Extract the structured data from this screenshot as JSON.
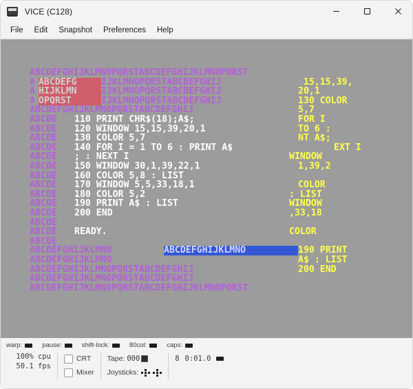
{
  "window": {
    "title": "VICE (C128)",
    "icon": "computer-monitor-icon",
    "minimize_label": "─",
    "maximize_label": "□",
    "close_label": "✕"
  },
  "menubar": {
    "items": [
      {
        "label": "File"
      },
      {
        "label": "Edit"
      },
      {
        "label": "Snapshot"
      },
      {
        "label": "Preferences"
      },
      {
        "label": "Help"
      }
    ]
  },
  "colors": {
    "screen_background": "#9c9c9c",
    "purple_text": "#b35fd8",
    "white_text": "#ffffff",
    "yellow_text": "#ffff4d",
    "reverse_red_bg": "#cf5d6b",
    "reverse_blue_bg": "#3457d5",
    "window_chrome": "#f3f3f3"
  },
  "screen": {
    "columns": 40,
    "rows": 25,
    "rows_data": [
      {
        "index": 0,
        "segments": [
          {
            "color": "purple",
            "text": "ABCDEFGHIJKLMNOPQRSTABCDEFGHIJKLMNOPQRST"
          }
        ]
      },
      {
        "index": 1,
        "segments": [
          {
            "color": "purple",
            "text": "A"
          },
          {
            "color": "revred",
            "text": "ABCDEFG"
          },
          {
            "color": "purple",
            "text": "IJKLMNOPQRSTABCDEFGHIJ"
          },
          {
            "color": "yellow",
            "text": " 15,15,39,"
          }
        ]
      },
      {
        "index": 2,
        "segments": [
          {
            "color": "purple",
            "text": "A"
          },
          {
            "color": "revred",
            "text": "HIJKLMN"
          },
          {
            "color": "purple",
            "text": "IJKLMNOPQRSTABCDEFGHIJ"
          },
          {
            "color": "yellow",
            "text": "20,1"
          }
        ]
      },
      {
        "index": 3,
        "segments": [
          {
            "color": "purple",
            "text": "A"
          },
          {
            "color": "revred",
            "text": "OPQRST "
          },
          {
            "color": "purple",
            "text": "IJKLMNOPQRSTABCDEFGHIJ"
          },
          {
            "color": "yellow",
            "text": "130 COLOR"
          }
        ]
      },
      {
        "index": 4,
        "segments": [
          {
            "color": "purple",
            "text": "ABCDEFGHIJKLMNOPQRSTABCDEFGHIJ"
          },
          {
            "color": "yellow",
            "text": "5,7"
          }
        ]
      },
      {
        "index": 5,
        "segments": [
          {
            "color": "purple",
            "text": "ABCDE"
          },
          {
            "color": "white",
            "text": "110 PRINT CHR$(18);A$;   "
          },
          {
            "color": "yellow",
            "text": "FOR I"
          }
        ]
      },
      {
        "index": 6,
        "segments": [
          {
            "color": "purple",
            "text": "ABCDE"
          },
          {
            "color": "white",
            "text": "120 WINDOW 15,15,39,20,1 "
          },
          {
            "color": "yellow",
            "text": "TO 6 :"
          }
        ]
      },
      {
        "index": 7,
        "segments": [
          {
            "color": "purple",
            "text": "ABCDE"
          },
          {
            "color": "white",
            "text": "130 COLOR 5,7            "
          },
          {
            "color": "yellow",
            "text": "NT A$;"
          }
        ]
      },
      {
        "index": 8,
        "segments": [
          {
            "color": "purple",
            "text": "ABCDE"
          },
          {
            "color": "white",
            "text": "140 FOR I = 1 TO 6 : PRINT A$"
          },
          {
            "color": "yellow",
            "text": "EXT I"
          }
        ]
      },
      {
        "index": 9,
        "segments": [
          {
            "color": "purple",
            "text": "ABCDE"
          },
          {
            "color": "white",
            "text": "; : NEXT I              "
          },
          {
            "color": "yellow",
            "text": "WINDOW"
          }
        ]
      },
      {
        "index": 10,
        "segments": [
          {
            "color": "purple",
            "text": "ABCDE"
          },
          {
            "color": "white",
            "text": "150 WINDOW 30,1,39,22,1  "
          },
          {
            "color": "yellow",
            "text": "1,39,2"
          }
        ]
      },
      {
        "index": 11,
        "segments": [
          {
            "color": "purple",
            "text": "ABCDE"
          },
          {
            "color": "white",
            "text": "160 COLOR 5,8 : LIST"
          }
        ]
      },
      {
        "index": 12,
        "segments": [
          {
            "color": "purple",
            "text": "ABCDE"
          },
          {
            "color": "white",
            "text": "170 WINDOW 5,5,33,18,1   "
          },
          {
            "color": "yellow",
            "text": "COLOR"
          }
        ]
      },
      {
        "index": 13,
        "segments": [
          {
            "color": "purple",
            "text": "ABCDE"
          },
          {
            "color": "white",
            "text": "180 COLOR 5,2           "
          },
          {
            "color": "yellow",
            "text": ": LIST"
          }
        ]
      },
      {
        "index": 14,
        "segments": [
          {
            "color": "purple",
            "text": "ABCDE"
          },
          {
            "color": "white",
            "text": "190 PRINT A$ : LIST     "
          },
          {
            "color": "yellow",
            "text": "WINDOW"
          }
        ]
      },
      {
        "index": 15,
        "segments": [
          {
            "color": "purple",
            "text": "ABCDE"
          },
          {
            "color": "white",
            "text": "200 END                 "
          },
          {
            "color": "yellow",
            "text": ",33,18"
          }
        ]
      },
      {
        "index": 16,
        "segments": [
          {
            "color": "purple",
            "text": "ABCDE"
          }
        ]
      },
      {
        "index": 17,
        "segments": [
          {
            "color": "purple",
            "text": "ABCDE"
          },
          {
            "color": "white",
            "text": "READY.                  "
          },
          {
            "color": "yellow",
            "text": "COLOR"
          }
        ]
      },
      {
        "index": 18,
        "segments": [
          {
            "color": "purple",
            "text": "ABCDE"
          }
        ]
      },
      {
        "index": 19,
        "segments": [
          {
            "color": "purple",
            "text": "ABCDEFGHIJKLMNO"
          },
          {
            "color": "revblue",
            "text": "ABCDEFGHIJKLMNO"
          },
          {
            "color": "yellow",
            "text": "190 PRINT"
          }
        ]
      },
      {
        "index": 20,
        "segments": [
          {
            "color": "purple",
            "text": "ABCDEFGHIJKLMNO"
          },
          {
            "color": "white",
            "text": "               "
          },
          {
            "color": "yellow",
            "text": "A$ : LIST"
          }
        ]
      },
      {
        "index": 21,
        "segments": [
          {
            "color": "purple",
            "text": "ABCDEFGHIJKLMNOPQRSTABCDEFGHIJ"
          },
          {
            "color": "yellow",
            "text": "200 END"
          }
        ]
      },
      {
        "index": 22,
        "segments": [
          {
            "color": "purple",
            "text": "ABCDEFGHIJKLMNOPQRSTABCDEFGHIJ"
          }
        ]
      },
      {
        "index": 23,
        "segments": [
          {
            "color": "purple",
            "text": "ABCDEFGHIJKLMNOPQRSTABCDEFGHIJKLMNOPQRST"
          }
        ]
      },
      {
        "index": 24,
        "segments": []
      }
    ]
  },
  "statusbar": {
    "warp_label": "warp:",
    "pause_label": "pause:",
    "shiftlock_label": "shift-lock:",
    "col80_label": "80col:",
    "caps_label": "caps:",
    "cpu_line": "100% cpu",
    "fps_line": "50.1 fps",
    "crt_label": "CRT",
    "crt_checked": false,
    "mixer_label": "Mixer",
    "mixer_checked": false,
    "tape_label": "Tape:",
    "tape_counter": "000",
    "joysticks_label": "Joysticks:",
    "drive_number": "8",
    "drive_time": "0:01.0"
  }
}
